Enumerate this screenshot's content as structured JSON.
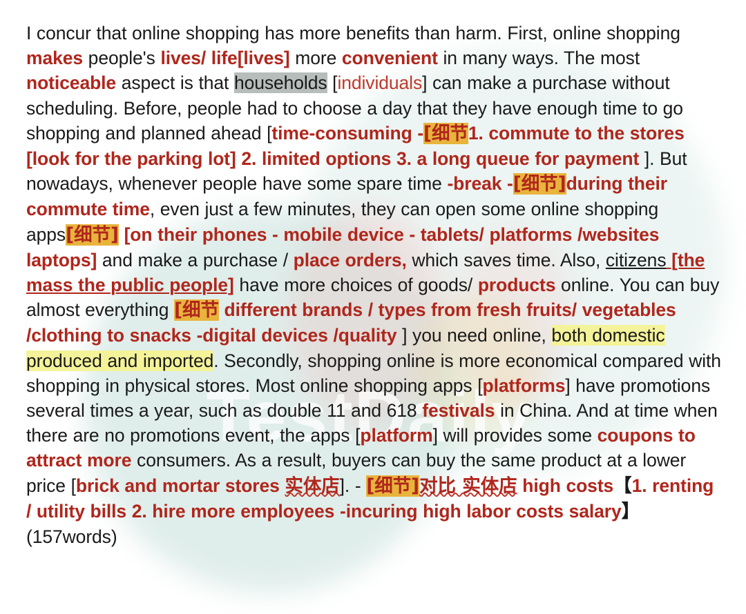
{
  "document": {
    "type": "annotated-essay-correction",
    "word_count_label": "(157words)",
    "watermark_text": "TestDaily",
    "colors": {
      "correction_red": "#b0261c",
      "light_red": "#c0392b",
      "gold_highlight": "#e8b43c",
      "yellow_highlight": "#f4f39a",
      "gray_highlight": "#b6bdba",
      "body_text": "#1a1a1a",
      "page_background": "#ffffff"
    },
    "annotation_tag": "[细节",
    "annotation_tag_closed": "[细节]",
    "runs": [
      {
        "id": "r1",
        "text": "I concur that online shopping has more benefits than harm. First, online shopping ",
        "style": "plain"
      },
      {
        "id": "r2",
        "text": "makes",
        "style": "red"
      },
      {
        "id": "r3",
        "text": " people's ",
        "style": "plain"
      },
      {
        "id": "r4",
        "text": "lives/ life[lives]",
        "style": "red"
      },
      {
        "id": "r5",
        "text": " more ",
        "style": "plain"
      },
      {
        "id": "r6",
        "text": "convenient",
        "style": "red"
      },
      {
        "id": "r7",
        "text": " in many ways. The most ",
        "style": "plain"
      },
      {
        "id": "r8",
        "text": "noticeable",
        "style": "red"
      },
      {
        "id": "r9",
        "text": " aspect is that ",
        "style": "plain"
      },
      {
        "id": "r10",
        "text": "households",
        "style": "hl-gray"
      },
      {
        "id": "r11",
        "text": " [",
        "style": "plain"
      },
      {
        "id": "r12",
        "text": "individuals",
        "style": "red-light"
      },
      {
        "id": "r13",
        "text": "] can make a purchase without scheduling. Before, people had to choose a day that they have enough time to go shopping and planned ahead [",
        "style": "plain"
      },
      {
        "id": "r14",
        "text": "time-consuming -",
        "style": "red"
      },
      {
        "id": "r15",
        "text": "[细节",
        "style": "hl-gold"
      },
      {
        "id": "r16",
        "text": "1. commute to the stores [look for the parking lot] 2. limited options 3. a long queue for payment",
        "style": "red"
      },
      {
        "id": "r17",
        "text": " ]. But nowadays, whenever people have some spare time ",
        "style": "plain"
      },
      {
        "id": "r18",
        "text": "-break -",
        "style": "red"
      },
      {
        "id": "r19",
        "text": "[细节]",
        "style": "hl-gold"
      },
      {
        "id": "r20",
        "text": "during their commute time",
        "style": "red"
      },
      {
        "id": "r21",
        "text": ", even just a few minutes, they can open some online shopping apps",
        "style": "plain"
      },
      {
        "id": "r22",
        "text": "[细节]",
        "style": "hl-gold"
      },
      {
        "id": "r23",
        "text": " [on their phones - mobile device - tablets/ platforms /websites laptops]",
        "style": "red"
      },
      {
        "id": "r24",
        "text": " and make a purchase / ",
        "style": "plain"
      },
      {
        "id": "r25",
        "text": "place orders,",
        "style": "red"
      },
      {
        "id": "r26",
        "text": " which saves time. Also, ",
        "style": "plain"
      },
      {
        "id": "r27",
        "text": "citizens",
        "style": "plain-underline"
      },
      {
        "id": "r28",
        "text": " [the mass the public people]",
        "style": "red-underline"
      },
      {
        "id": "r29",
        "text": " have more choices of goods/ ",
        "style": "plain"
      },
      {
        "id": "r30",
        "text": "products",
        "style": "red"
      },
      {
        "id": "r31",
        "text": " online. You can buy almost everything ",
        "style": "plain"
      },
      {
        "id": "r32",
        "text": "[细节",
        "style": "hl-gold"
      },
      {
        "id": "r33",
        "text": " different brands / types from fresh fruits/ vegetables /clothing to snacks -digital devices  /quality",
        "style": "red"
      },
      {
        "id": "r34",
        "text": " ] you need online, ",
        "style": "plain"
      },
      {
        "id": "r35",
        "text": "both domestic produced and imported",
        "style": "hl-yellow"
      },
      {
        "id": "r36",
        "text": ". Secondly, shopping online is more economical compared with shopping in physical stores. Most online shopping apps [",
        "style": "plain"
      },
      {
        "id": "r37",
        "text": "platforms",
        "style": "red"
      },
      {
        "id": "r38",
        "text": "] have promotions several times a year, such as double 11 and 618 ",
        "style": "plain"
      },
      {
        "id": "r39",
        "text": "festivals",
        "style": "red"
      },
      {
        "id": "r40",
        "text": " in China. And at time when there are no promotions event, the apps [",
        "style": "plain"
      },
      {
        "id": "r41",
        "text": "platform",
        "style": "red"
      },
      {
        "id": "r42",
        "text": "] will provides some ",
        "style": "plain"
      },
      {
        "id": "r43",
        "text": "coupons to attract more",
        "style": "red"
      },
      {
        "id": "r44",
        "text": " consumers. As a result, buyers can buy the same product at a lower price [",
        "style": "plain"
      },
      {
        "id": "r45",
        "text": "brick and mortar stores ",
        "style": "red"
      },
      {
        "id": "r46",
        "text": "实体店",
        "style": "red-wavy"
      },
      {
        "id": "r47",
        "text": "]. - ",
        "style": "plain"
      },
      {
        "id": "r48",
        "text": "[细节]",
        "style": "hl-gold"
      },
      {
        "id": "r49",
        "text": "对比 实体店",
        "style": "red-wavy"
      },
      {
        "id": "r50",
        "text": " high costs",
        "style": "red"
      },
      {
        "id": "r51",
        "text": "【",
        "style": "bracket-black"
      },
      {
        "id": "r52",
        "text": "1. renting / utility bills 2. hire more employees -incuring high labor costs salary",
        "style": "red"
      },
      {
        "id": "r53",
        "text": "】",
        "style": "bracket-black"
      },
      {
        "id": "r54",
        "text": "  (157words)",
        "style": "plain"
      }
    ]
  }
}
